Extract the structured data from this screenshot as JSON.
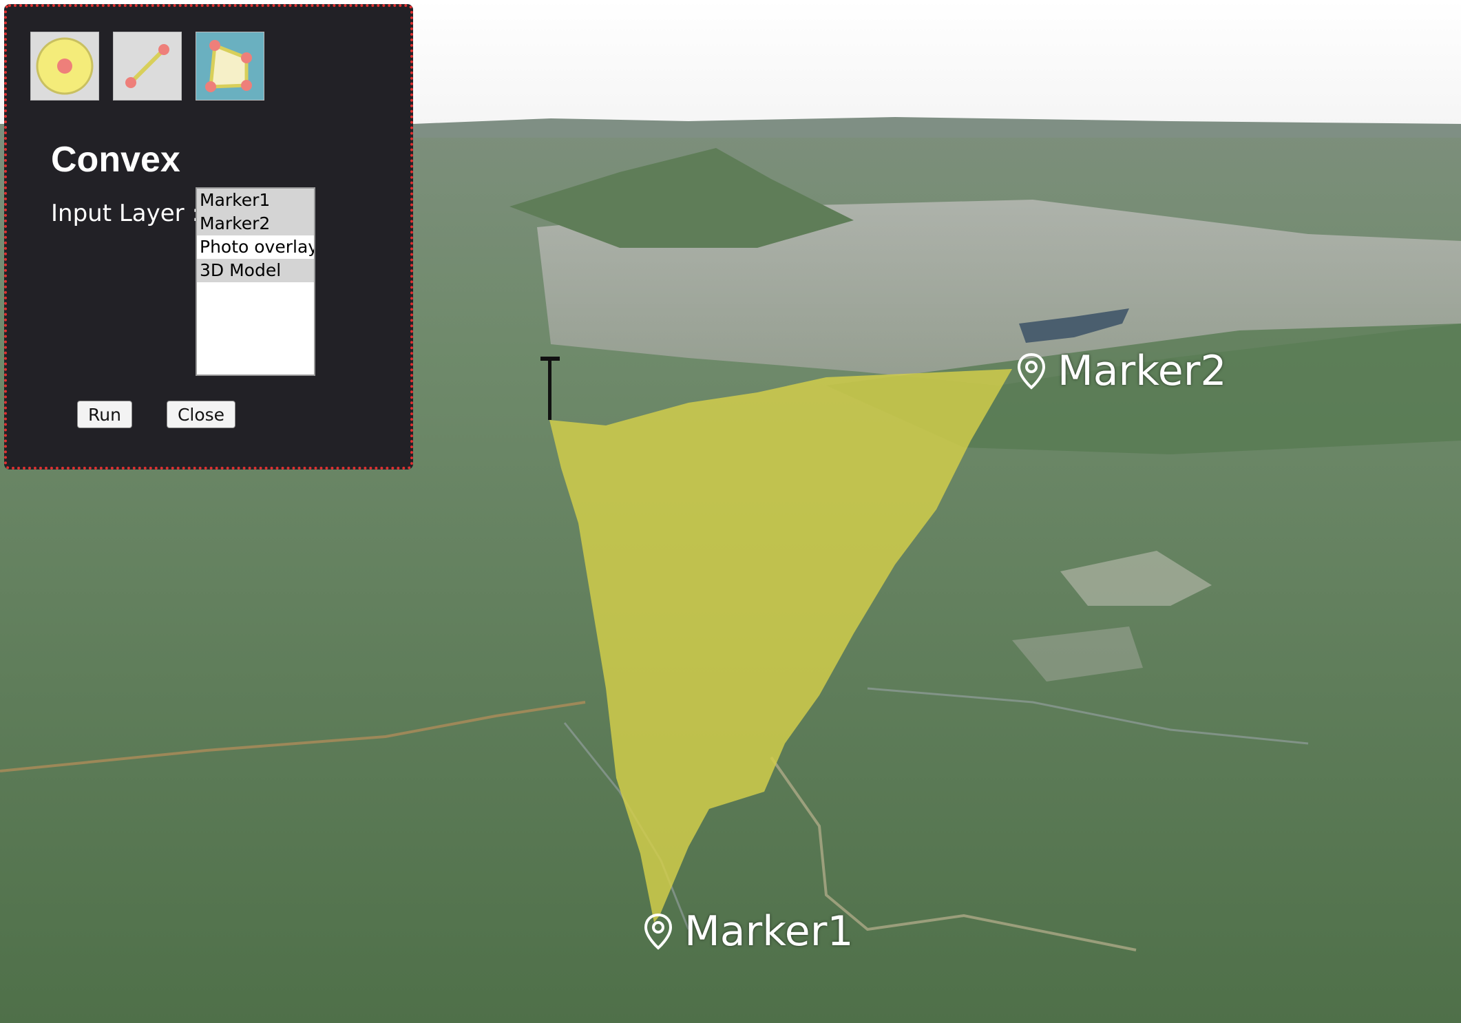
{
  "panel": {
    "tools": [
      {
        "name": "buffer-tool-icon",
        "active": false
      },
      {
        "name": "line-tool-icon",
        "active": false
      },
      {
        "name": "convex-tool-icon",
        "active": true
      }
    ],
    "title": "Convex",
    "input_label": "Input Layer :",
    "layers": [
      {
        "label": "Marker1",
        "selected": true
      },
      {
        "label": "Marker2",
        "selected": true
      },
      {
        "label": "Photo overlay",
        "selected": false
      },
      {
        "label": "3D Model",
        "selected": true
      }
    ],
    "run_label": "Run",
    "close_label": "Close"
  },
  "map": {
    "markers": [
      {
        "label": "Marker1"
      },
      {
        "label": "Marker2"
      }
    ],
    "hull_color": "#d4cf4a"
  }
}
